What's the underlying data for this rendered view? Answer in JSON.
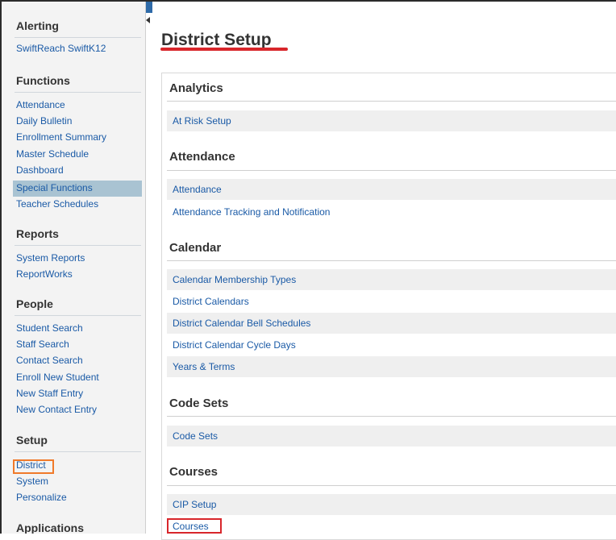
{
  "sidebar": {
    "alerting": {
      "heading": "Alerting",
      "items": [
        "SwiftReach SwiftK12"
      ]
    },
    "functions": {
      "heading": "Functions",
      "items": [
        "Attendance",
        "Daily Bulletin",
        "Enrollment Summary",
        "Master Schedule",
        "Dashboard",
        "Special Functions",
        "Teacher Schedules"
      ],
      "selected": "Special Functions"
    },
    "reports": {
      "heading": "Reports",
      "items": [
        "System Reports",
        "ReportWorks"
      ]
    },
    "people": {
      "heading": "People",
      "items": [
        "Student Search",
        "Staff Search",
        "Contact Search",
        "Enroll New Student",
        "New Staff Entry",
        "New Contact Entry"
      ]
    },
    "setup": {
      "heading": "Setup",
      "items": [
        "District",
        "System",
        "Personalize"
      ]
    },
    "applications": {
      "heading": "Applications"
    }
  },
  "main": {
    "title": "District Setup",
    "sections": [
      {
        "heading": "Analytics",
        "items": [
          "At Risk Setup"
        ]
      },
      {
        "heading": "Attendance",
        "items": [
          "Attendance",
          "Attendance Tracking and Notification"
        ]
      },
      {
        "heading": "Calendar",
        "items": [
          "Calendar Membership Types",
          "District Calendars",
          "District Calendar Bell Schedules",
          "District Calendar Cycle Days",
          "Years & Terms"
        ]
      },
      {
        "heading": "Code Sets",
        "items": [
          "Code Sets"
        ]
      },
      {
        "heading": "Courses",
        "items": [
          "CIP Setup",
          "Courses"
        ]
      }
    ]
  },
  "colors": {
    "link": "#1a5aa6",
    "selected_bg": "#a9c3d2",
    "highlight_orange": "#f07a2a",
    "highlight_red": "#d8262b"
  }
}
